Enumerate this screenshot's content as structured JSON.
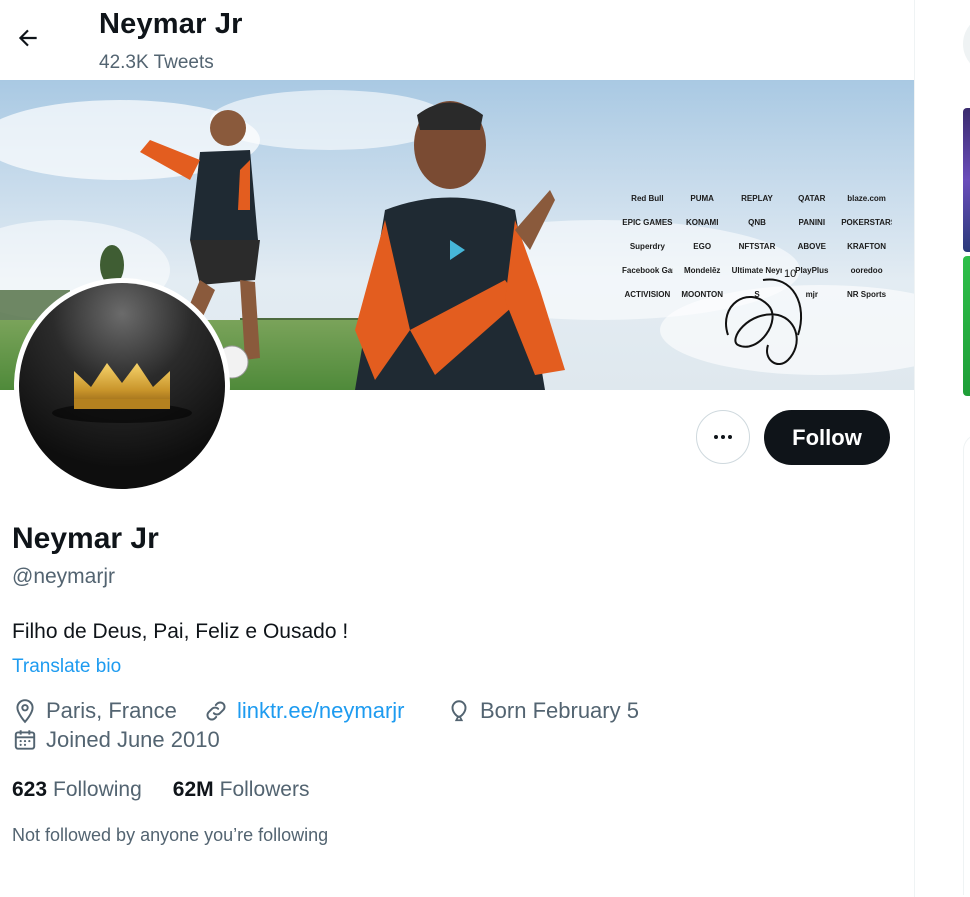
{
  "header": {
    "back_icon": "arrow-left-icon",
    "name": "Neymar Jr",
    "tweet_count": "42.3K Tweets"
  },
  "banner": {
    "sponsors": [
      "Red Bull",
      "PUMA",
      "REPLAY",
      "QATAR",
      "blaze.com",
      "EPIC GAMES",
      "KONAMI",
      "QNB",
      "PANINI",
      "POKERSTARS",
      "Superdry",
      "EGO",
      "NFTSTAR",
      "ABOVE",
      "KRAFTON",
      "Facebook Gaming",
      "Mondelēz",
      "Ultimate Neymar",
      "PlayPlus",
      "ooredoo",
      "ACTIVISION",
      "MOONTON",
      "S",
      "mjr",
      "NR Sports"
    ],
    "signature_number": "10"
  },
  "avatar": {
    "description_icon": "crown-icon"
  },
  "actions": {
    "more_icon": "more-dots-icon",
    "follow_label": "Follow"
  },
  "profile": {
    "name": "Neymar Jr",
    "handle": "@neymarjr",
    "bio": "Filho de Deus, Pai, Feliz e Ousado !",
    "translate_label": "Translate bio",
    "location": "Paris, France",
    "website": "linktr.ee/neymarjr",
    "birthday": "Born February 5",
    "joined": "Joined June 2010"
  },
  "stats": {
    "following_count": "623",
    "following_label": "Following",
    "followers_count": "62M",
    "followers_label": "Followers"
  },
  "not_followed_text": "Not followed by anyone you’re following",
  "colors": {
    "accent": "#1d9bf0",
    "text_primary": "#0f1419",
    "text_secondary": "#536471",
    "follow_button_bg": "#0f1419"
  }
}
